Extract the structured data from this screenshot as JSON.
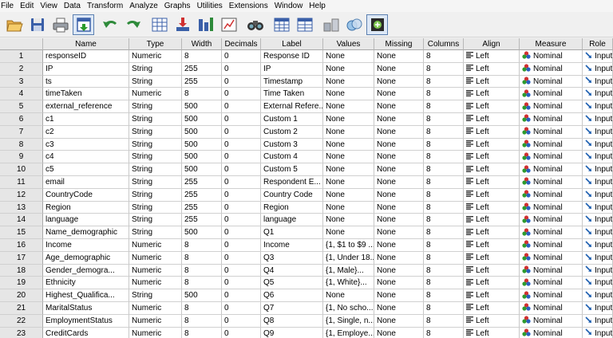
{
  "menu": [
    "File",
    "Edit",
    "View",
    "Data",
    "Transform",
    "Analyze",
    "Graphs",
    "Utilities",
    "Extensions",
    "Window",
    "Help"
  ],
  "toolbar": [
    "open-icon",
    "save-icon",
    "print-icon",
    "dialog-recall-icon",
    "undo-icon",
    "redo-icon",
    "goto-case-icon",
    "goto-variable-icon",
    "variables-icon",
    "run-descriptives-icon",
    "find-icon",
    "insert-cases-icon",
    "insert-variable-icon",
    "split-file-icon",
    "select-cases-icon",
    "value-labels-icon",
    "use-sets-icon"
  ],
  "columns": [
    "",
    "Name",
    "Type",
    "Width",
    "Decimals",
    "Label",
    "Values",
    "Missing",
    "Columns",
    "Align",
    "Measure",
    "Role"
  ],
  "colors": {
    "align": "#2a2a2a",
    "role": "#1d5fb0",
    "measure_red": "#d03030",
    "measure_green": "#2e9a2e",
    "measure_blue": "#2a5fc0"
  },
  "rows": [
    {
      "num": "1",
      "name": "responseID",
      "type": "Numeric",
      "width": "8",
      "decimals": "0",
      "label": "Response ID",
      "values": "None",
      "missing": "None",
      "columns": "8",
      "align": "Left",
      "measure": "Nominal",
      "role": "Input"
    },
    {
      "num": "2",
      "name": "IP",
      "type": "String",
      "width": "255",
      "decimals": "0",
      "label": "IP",
      "values": "None",
      "missing": "None",
      "columns": "8",
      "align": "Left",
      "measure": "Nominal",
      "role": "Input"
    },
    {
      "num": "3",
      "name": "ts",
      "type": "String",
      "width": "255",
      "decimals": "0",
      "label": "Timestamp",
      "values": "None",
      "missing": "None",
      "columns": "8",
      "align": "Left",
      "measure": "Nominal",
      "role": "Input"
    },
    {
      "num": "4",
      "name": "timeTaken",
      "type": "Numeric",
      "width": "8",
      "decimals": "0",
      "label": "Time Taken",
      "values": "None",
      "missing": "None",
      "columns": "8",
      "align": "Left",
      "measure": "Nominal",
      "role": "Input"
    },
    {
      "num": "5",
      "name": "external_reference",
      "type": "String",
      "width": "500",
      "decimals": "0",
      "label": "External Refere...",
      "values": "None",
      "missing": "None",
      "columns": "8",
      "align": "Left",
      "measure": "Nominal",
      "role": "Input"
    },
    {
      "num": "6",
      "name": "c1",
      "type": "String",
      "width": "500",
      "decimals": "0",
      "label": "Custom 1",
      "values": "None",
      "missing": "None",
      "columns": "8",
      "align": "Left",
      "measure": "Nominal",
      "role": "Input"
    },
    {
      "num": "7",
      "name": "c2",
      "type": "String",
      "width": "500",
      "decimals": "0",
      "label": "Custom 2",
      "values": "None",
      "missing": "None",
      "columns": "8",
      "align": "Left",
      "measure": "Nominal",
      "role": "Input"
    },
    {
      "num": "8",
      "name": "c3",
      "type": "String",
      "width": "500",
      "decimals": "0",
      "label": "Custom 3",
      "values": "None",
      "missing": "None",
      "columns": "8",
      "align": "Left",
      "measure": "Nominal",
      "role": "Input"
    },
    {
      "num": "9",
      "name": "c4",
      "type": "String",
      "width": "500",
      "decimals": "0",
      "label": "Custom 4",
      "values": "None",
      "missing": "None",
      "columns": "8",
      "align": "Left",
      "measure": "Nominal",
      "role": "Input"
    },
    {
      "num": "10",
      "name": "c5",
      "type": "String",
      "width": "500",
      "decimals": "0",
      "label": "Custom 5",
      "values": "None",
      "missing": "None",
      "columns": "8",
      "align": "Left",
      "measure": "Nominal",
      "role": "Input"
    },
    {
      "num": "11",
      "name": "email",
      "type": "String",
      "width": "255",
      "decimals": "0",
      "label": "Respondent E...",
      "values": "None",
      "missing": "None",
      "columns": "8",
      "align": "Left",
      "measure": "Nominal",
      "role": "Input"
    },
    {
      "num": "12",
      "name": "CountryCode",
      "type": "String",
      "width": "255",
      "decimals": "0",
      "label": "Country Code",
      "values": "None",
      "missing": "None",
      "columns": "8",
      "align": "Left",
      "measure": "Nominal",
      "role": "Input"
    },
    {
      "num": "13",
      "name": "Region",
      "type": "String",
      "width": "255",
      "decimals": "0",
      "label": "Region",
      "values": "None",
      "missing": "None",
      "columns": "8",
      "align": "Left",
      "measure": "Nominal",
      "role": "Input"
    },
    {
      "num": "14",
      "name": "language",
      "type": "String",
      "width": "255",
      "decimals": "0",
      "label": "language",
      "values": "None",
      "missing": "None",
      "columns": "8",
      "align": "Left",
      "measure": "Nominal",
      "role": "Input"
    },
    {
      "num": "15",
      "name": "Name_demographic",
      "type": "String",
      "width": "500",
      "decimals": "0",
      "label": "Q1",
      "values": "None",
      "missing": "None",
      "columns": "8",
      "align": "Left",
      "measure": "Nominal",
      "role": "Input"
    },
    {
      "num": "16",
      "name": "Income",
      "type": "Numeric",
      "width": "8",
      "decimals": "0",
      "label": "Income",
      "values": "{1, $1 to $9 ...",
      "missing": "None",
      "columns": "8",
      "align": "Left",
      "measure": "Nominal",
      "role": "Input"
    },
    {
      "num": "17",
      "name": "Age_demographic",
      "type": "Numeric",
      "width": "8",
      "decimals": "0",
      "label": "Q3",
      "values": "{1, Under 18...",
      "missing": "None",
      "columns": "8",
      "align": "Left",
      "measure": "Nominal",
      "role": "Input"
    },
    {
      "num": "18",
      "name": "Gender_demogra...",
      "type": "Numeric",
      "width": "8",
      "decimals": "0",
      "label": "Q4",
      "values": "{1, Male}...",
      "missing": "None",
      "columns": "8",
      "align": "Left",
      "measure": "Nominal",
      "role": "Input"
    },
    {
      "num": "19",
      "name": "Ethnicity",
      "type": "Numeric",
      "width": "8",
      "decimals": "0",
      "label": "Q5",
      "values": "{1, White}...",
      "missing": "None",
      "columns": "8",
      "align": "Left",
      "measure": "Nominal",
      "role": "Input"
    },
    {
      "num": "20",
      "name": "Highest_Qualifica...",
      "type": "String",
      "width": "500",
      "decimals": "0",
      "label": "Q6",
      "values": "None",
      "missing": "None",
      "columns": "8",
      "align": "Left",
      "measure": "Nominal",
      "role": "Input"
    },
    {
      "num": "21",
      "name": "MaritalStatus",
      "type": "Numeric",
      "width": "8",
      "decimals": "0",
      "label": "Q7",
      "values": "{1, No scho...",
      "missing": "None",
      "columns": "8",
      "align": "Left",
      "measure": "Nominal",
      "role": "Input"
    },
    {
      "num": "22",
      "name": "EmploymentStatus",
      "type": "Numeric",
      "width": "8",
      "decimals": "0",
      "label": "Q8",
      "values": "{1, Single, n...",
      "missing": "None",
      "columns": "8",
      "align": "Left",
      "measure": "Nominal",
      "role": "Input"
    },
    {
      "num": "23",
      "name": "CreditCards",
      "type": "Numeric",
      "width": "8",
      "decimals": "0",
      "label": "Q9",
      "values": "{1, Employe...",
      "missing": "None",
      "columns": "8",
      "align": "Left",
      "measure": "Nominal",
      "role": "Input"
    }
  ]
}
